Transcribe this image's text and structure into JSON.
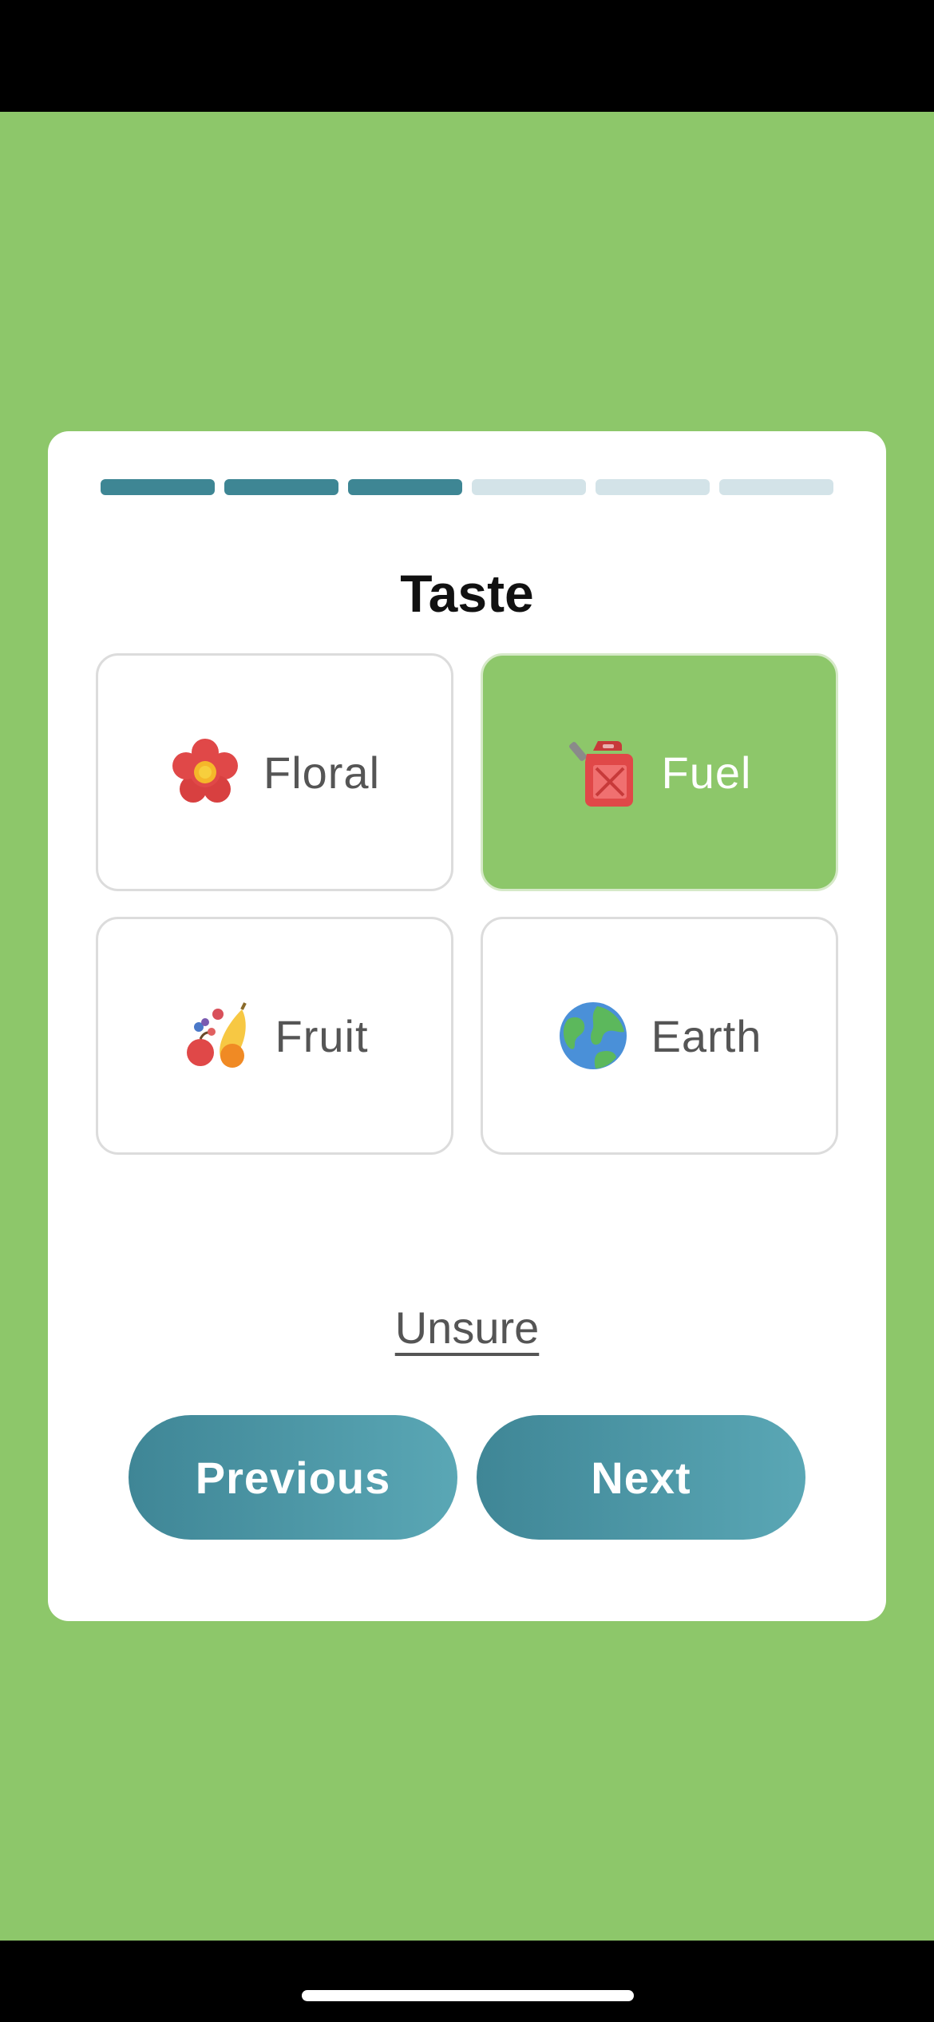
{
  "progress": {
    "total_steps": 6,
    "completed_steps": 3
  },
  "question": {
    "title": "Taste"
  },
  "options": [
    {
      "label": "Floral",
      "icon": "flower-icon",
      "selected": false
    },
    {
      "label": "Fuel",
      "icon": "fuel-can-icon",
      "selected": true
    },
    {
      "label": "Fruit",
      "icon": "fruit-icon",
      "selected": false
    },
    {
      "label": "Earth",
      "icon": "globe-icon",
      "selected": false
    }
  ],
  "unsure_label": "Unsure",
  "nav": {
    "previous_label": "Previous",
    "next_label": "Next"
  },
  "colors": {
    "background": "#8dc76a",
    "selected_option": "#8dc76a",
    "progress_active": "#3e8694",
    "progress_inactive": "#d3e3e8",
    "button_gradient_start": "#3f8696",
    "button_gradient_end": "#5aa7b5"
  }
}
